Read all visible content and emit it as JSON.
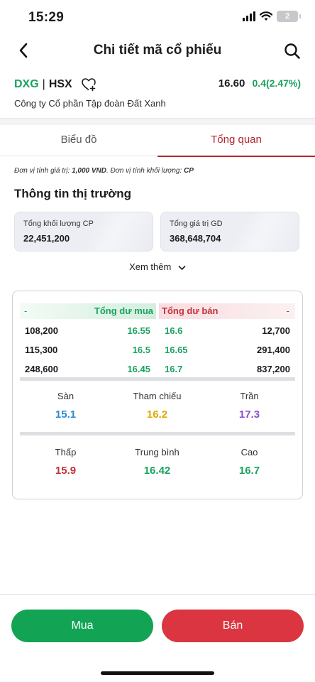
{
  "status_bar": {
    "time": "15:29",
    "battery": "2"
  },
  "header": {
    "title": "Chi tiết mã cổ phiếu"
  },
  "stock": {
    "symbol": "DXG",
    "separator": "|",
    "exchange": "HSX",
    "price": "16.60",
    "change": "0.4(2.47%)",
    "company": "Công ty Cổ phần Tập đoàn Đất Xanh"
  },
  "tabs": [
    {
      "label": "Biểu đồ",
      "active": false
    },
    {
      "label": "Tổng quan",
      "active": true
    }
  ],
  "unit_note": {
    "part1": "Đơn vị tính giá trị: ",
    "value_unit": "1,000 VND",
    "part2": ". Đơn vị tính khối lượng: ",
    "volume_unit": "CP"
  },
  "market": {
    "title": "Thông tin thị trường",
    "cards": [
      {
        "label": "Tổng khối lượng CP",
        "value": "22,451,200"
      },
      {
        "label": "Tổng giá trị GD",
        "value": "368,648,704"
      }
    ],
    "see_more": "Xem thêm"
  },
  "order_book": {
    "buy_dash": "-",
    "buy_title": "Tổng dư mua",
    "sell_title": "Tổng dư bán",
    "sell_dash": "-",
    "rows": [
      {
        "buy_qty": "108,200",
        "buy_price": "16.55",
        "sell_price": "16.6",
        "sell_qty": "12,700"
      },
      {
        "buy_qty": "115,300",
        "buy_price": "16.5",
        "sell_price": "16.65",
        "sell_qty": "291,400"
      },
      {
        "buy_qty": "248,600",
        "buy_price": "16.45",
        "sell_price": "16.7",
        "sell_qty": "837,200"
      }
    ]
  },
  "reference": [
    {
      "label": "Sàn",
      "value": "15.1",
      "color": "#2b8ad6"
    },
    {
      "label": "Tham chiếu",
      "value": "16.2",
      "color": "#e0a800"
    },
    {
      "label": "Trần",
      "value": "17.3",
      "color": "#8a4fd4"
    }
  ],
  "daily": [
    {
      "label": "Thấp",
      "value": "15.9",
      "color": "#c0323c"
    },
    {
      "label": "Trung bình",
      "value": "16.42",
      "color": "#1aa260"
    },
    {
      "label": "Cao",
      "value": "16.7",
      "color": "#1aa260"
    }
  ],
  "actions": {
    "buy": "Mua",
    "sell": "Bán"
  }
}
